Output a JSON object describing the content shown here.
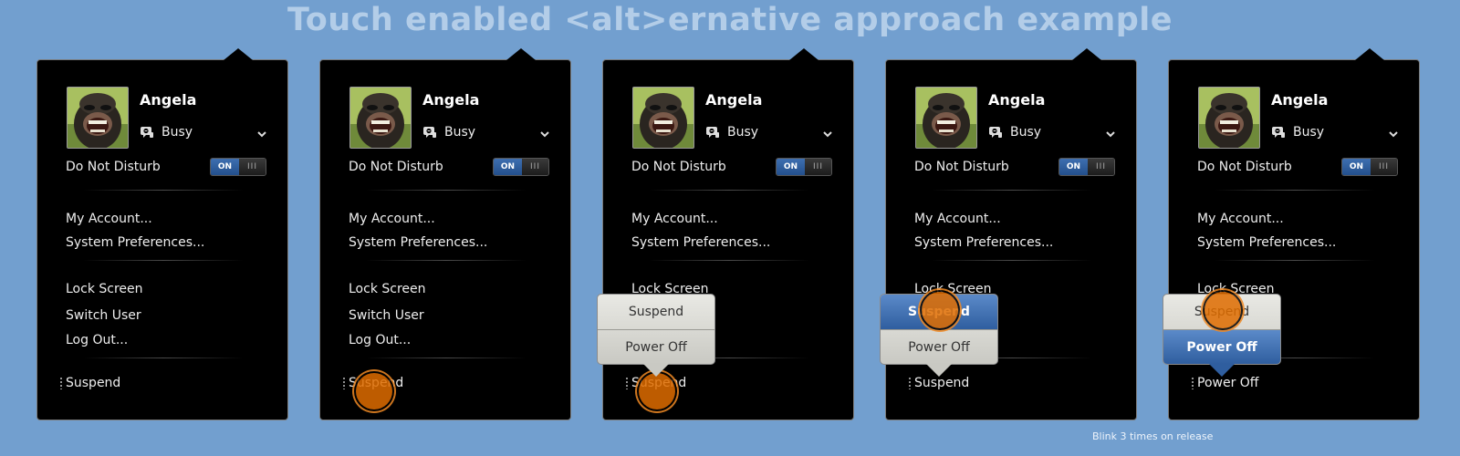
{
  "title": "Touch enabled <alt>ernative approach example",
  "panels": [
    {
      "user": {
        "name": "Angela",
        "status": "Busy",
        "status_icon": "busy-chat-icon"
      },
      "dnd": {
        "label": "Do Not Disturb",
        "toggle_on": "ON",
        "toggle_off": "III"
      },
      "menu": [
        "My Account...",
        "System Preferences...",
        "Lock Screen",
        "Switch User",
        "Log Out..."
      ],
      "footer": "Suspend"
    },
    {
      "user": {
        "name": "Angela",
        "status": "Busy",
        "status_icon": "busy-chat-icon"
      },
      "dnd": {
        "label": "Do Not Disturb",
        "toggle_on": "ON",
        "toggle_off": "III"
      },
      "menu": [
        "My Account...",
        "System Preferences...",
        "Lock Screen",
        "Switch User",
        "Log Out..."
      ],
      "footer": "Suspend"
    },
    {
      "user": {
        "name": "Angela",
        "status": "Busy",
        "status_icon": "busy-chat-icon"
      },
      "dnd": {
        "label": "Do Not Disturb",
        "toggle_on": "ON",
        "toggle_off": "III"
      },
      "menu": [
        "My Account...",
        "System Preferences...",
        "Lock Screen"
      ],
      "popup": {
        "options": [
          "Suspend",
          "Power Off"
        ],
        "highlighted": null
      },
      "footer": "Suspend"
    },
    {
      "user": {
        "name": "Angela",
        "status": "Busy",
        "status_icon": "busy-chat-icon"
      },
      "dnd": {
        "label": "Do Not Disturb",
        "toggle_on": "ON",
        "toggle_off": "III"
      },
      "menu": [
        "My Account...",
        "System Preferences...",
        "Lock Screen"
      ],
      "popup": {
        "options": [
          "Suspend",
          "Power Off"
        ],
        "highlighted": "Suspend"
      },
      "footer": "Suspend"
    },
    {
      "user": {
        "name": "Angela",
        "status": "Busy",
        "status_icon": "busy-chat-icon"
      },
      "dnd": {
        "label": "Do Not Disturb",
        "toggle_on": "ON",
        "toggle_off": "III"
      },
      "menu": [
        "My Account...",
        "System Preferences...",
        "Lock Screen"
      ],
      "popup": {
        "options": [
          "Suspend",
          "Power Off"
        ],
        "highlighted": "Power Off"
      },
      "footer": "Power Off"
    }
  ],
  "note": "Blink 3 times on release",
  "colors": {
    "background": "#729fcf",
    "panel": "#000000",
    "touch": "#e06d00",
    "highlight": "#3a6aa8"
  }
}
